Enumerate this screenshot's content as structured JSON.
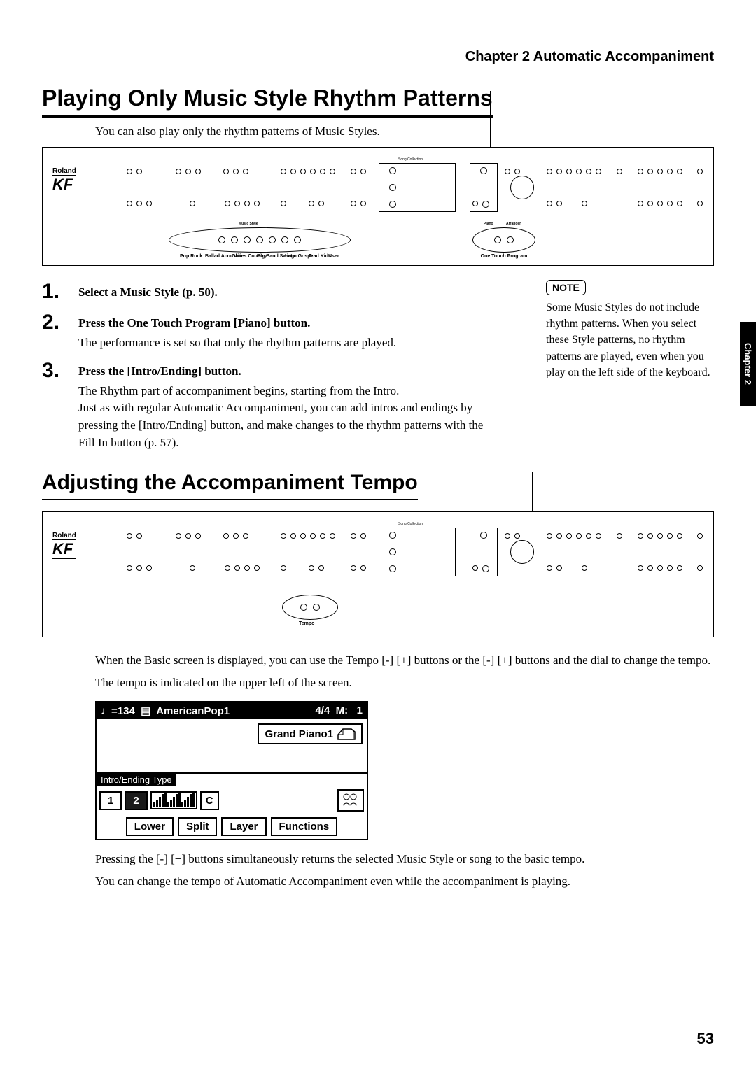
{
  "chapter_header": "Chapter 2  Automatic Accompaniment",
  "side_tab": "Chapter 2",
  "section1": {
    "title": "Playing Only Music Style Rhythm Patterns",
    "intro": "You can also play only the rhythm patterns of Music Styles.",
    "steps": [
      {
        "num": "1",
        "title": "Select a Music Style (p. 50).",
        "text": ""
      },
      {
        "num": "2",
        "title": "Press the One Touch Program [Piano] button.",
        "text": "The performance is set so that only the rhythm patterns are played."
      },
      {
        "num": "3",
        "title": "Press the [Intro/Ending] button.",
        "text": "The Rhythm part of accompaniment begins, starting from the Intro.\nJust as with regular Automatic Accompaniment, you can add intros and endings by pressing the [Intro/Ending] button, and make changes to the rhythm patterns with the Fill In button (p. 57)."
      }
    ],
    "note_label": "NOTE",
    "note_text": "Some Music Styles do not include rhythm patterns. When you select these Style patterns, no rhythm patterns are played, even when you play on the left side of the keyboard."
  },
  "section2": {
    "title": "Adjusting the Accompaniment Tempo",
    "para1": "When the Basic screen is displayed, you can use the Tempo [-] [+] buttons or the [-] [+] buttons and the dial to change the tempo.",
    "para2": "The tempo is indicated on the upper left of the screen.",
    "para3": "Pressing the [-] [+] buttons simultaneously returns the selected Music Style or song to the basic tempo.",
    "para4": "You can change the tempo of Automatic Accompaniment even while the accompaniment is playing."
  },
  "lcd": {
    "tempo": "♩=134",
    "disk_icon": "⌖",
    "style_name": "AmericanPop1",
    "timesig": "4/4",
    "measure_lbl": "M:",
    "measure": "1",
    "tone": "Grand Piano1",
    "section_label": "Intro/Ending Type",
    "btn_1": "1",
    "btn_2": "2",
    "chord": "C",
    "lower": "Lower",
    "split": "Split",
    "layer": "Layer",
    "functions": "Functions"
  },
  "panel": {
    "brand": "Roland",
    "model": "KF",
    "music_style_label": "Music Style",
    "style_buttons": [
      "Pop Rock",
      "Ballad Acoustic",
      "Oldies Country",
      "Big Band Swing",
      "Latin Gospel",
      "Trad Kids",
      "User"
    ],
    "song_collection": "Song Collection",
    "one_touch_label": "One Touch Program",
    "piano": "Piano",
    "arranger": "Arranger",
    "tempo": "Tempo"
  },
  "page_number": "53"
}
